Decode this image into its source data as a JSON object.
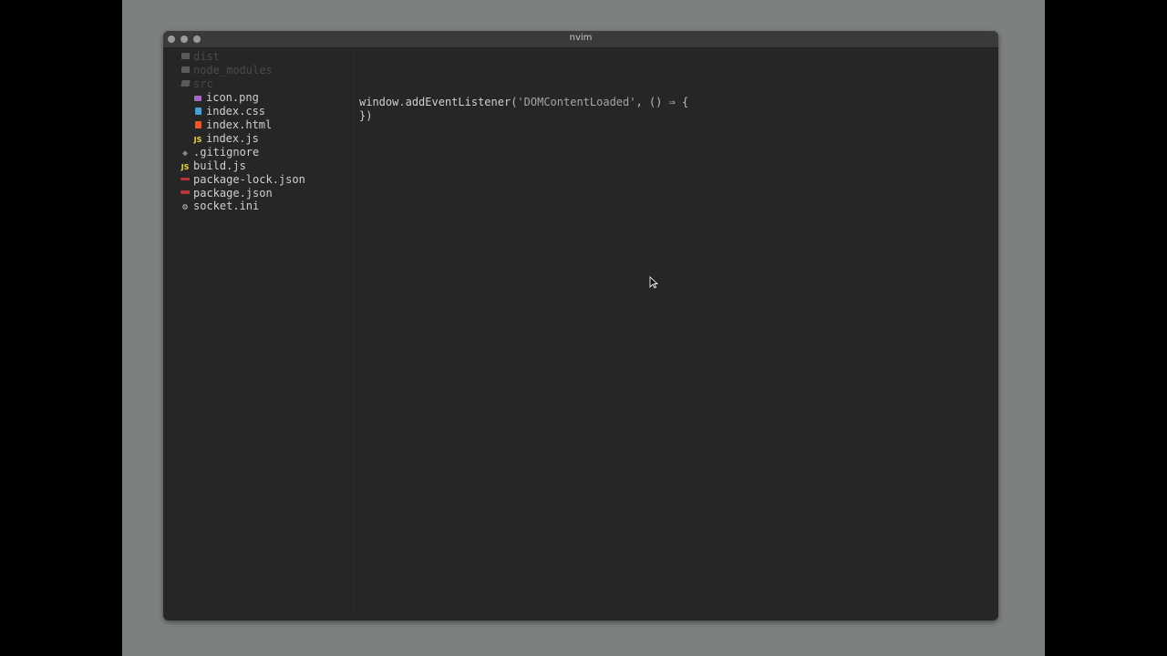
{
  "window": {
    "title": "nvim"
  },
  "tree": {
    "items": [
      {
        "label": "dist",
        "icon": "folder-icon",
        "state": "dim"
      },
      {
        "label": "node_modules",
        "icon": "folder-icon",
        "state": "dim"
      },
      {
        "label": "src",
        "icon": "folder-open-icon",
        "state": "dim"
      },
      {
        "label": "icon.png",
        "icon": "image-file-icon",
        "state": "normal"
      },
      {
        "label": "index.css",
        "icon": "css-file-icon",
        "state": "normal"
      },
      {
        "label": "index.html",
        "icon": "html-file-icon",
        "state": "normal"
      },
      {
        "label": "index.js",
        "icon": "js-file-icon",
        "state": "normal"
      },
      {
        "label": ".gitignore",
        "icon": "git-icon",
        "state": "normal"
      },
      {
        "label": "build.js",
        "icon": "js-file-icon",
        "state": "normal"
      },
      {
        "label": "package-lock.json",
        "icon": "npm-icon",
        "state": "normal"
      },
      {
        "label": "package.json",
        "icon": "npm-icon",
        "state": "normal"
      },
      {
        "label": "socket.ini",
        "icon": "gear-icon",
        "state": "normal"
      }
    ],
    "js_badge": "JS"
  },
  "editor": {
    "line1": {
      "ident": "window",
      "dot": ".",
      "method": "addEventListener",
      "open": "(",
      "string": "'DOMContentLoaded'",
      "rest": ", () ⇒ {"
    },
    "line2": "})"
  },
  "colors": {
    "css": "#4a9fd8",
    "html": "#e05a33",
    "js": "#e9d44c",
    "npm": "#b8353a",
    "image": "#a36bc4",
    "git": "#7a8f7a",
    "gear": "#b7c3d0"
  }
}
